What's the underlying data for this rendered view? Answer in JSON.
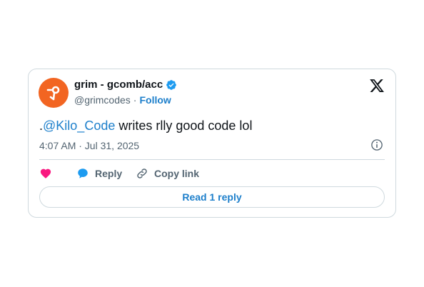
{
  "author": {
    "display_name": "grim - gcomb/acc",
    "handle": "@grimcodes",
    "separator": "·",
    "follow_label": "Follow",
    "avatar_color": "#f26522",
    "verified_color": "#1d9bf0"
  },
  "tweet": {
    "prefix": ".",
    "mention": "@Kilo_Code",
    "body": " writes rlly good code lol",
    "timestamp": "4:07 AM · Jul 31, 2025"
  },
  "actions": {
    "like_icon": "heart-icon",
    "reply_label": "Reply",
    "copy_link_label": "Copy link"
  },
  "footer": {
    "read_replies_label": "Read 1 reply"
  },
  "colors": {
    "link": "#1d7fcb",
    "heart": "#f91880",
    "text": "#0f1419",
    "muted": "#536471",
    "border": "#cfd9de"
  }
}
